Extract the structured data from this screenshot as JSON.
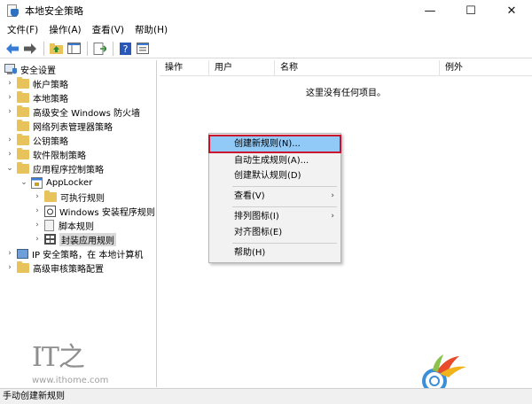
{
  "window": {
    "title": "本地安全策略",
    "minimize_glyph": "—",
    "maximize_glyph": "☐",
    "close_glyph": "✕"
  },
  "menubar": [
    {
      "label": "文件(F)"
    },
    {
      "label": "操作(A)"
    },
    {
      "label": "查看(V)"
    },
    {
      "label": "帮助(H)"
    }
  ],
  "toolbar": {
    "icons": [
      "back-arrow-icon",
      "forward-arrow-icon",
      "up-folder-icon",
      "show-hide-tree-icon",
      "export-list-icon",
      "help-icon",
      "properties-icon"
    ]
  },
  "tree": {
    "root": "安全设置",
    "items": [
      {
        "label": "帐户策略"
      },
      {
        "label": "本地策略"
      },
      {
        "label": "高级安全 Windows 防火墙"
      },
      {
        "label": "网络列表管理器策略"
      },
      {
        "label": "公钥策略"
      },
      {
        "label": "软件限制策略"
      },
      {
        "label": "应用程序控制策略"
      },
      {
        "label": "AppLocker"
      },
      {
        "label": "可执行规则"
      },
      {
        "label": "Windows 安装程序规则"
      },
      {
        "label": "脚本规则"
      },
      {
        "label": "封装应用规则"
      },
      {
        "label": "IP 安全策略，在 本地计算机"
      },
      {
        "label": "高级审核策略配置"
      }
    ]
  },
  "list": {
    "columns": [
      "操作",
      "用户",
      "名称",
      "例外"
    ],
    "empty_message": "这里没有任何项目。"
  },
  "context_menu": {
    "items": [
      {
        "label": "创建新规则(N)...",
        "highlighted": true
      },
      {
        "label": "自动生成规则(A)..."
      },
      {
        "label": "创建默认规则(D)"
      },
      {
        "label": "查看(V)",
        "submenu": true
      },
      {
        "label": "排列图标(I)",
        "submenu": true
      },
      {
        "label": "对齐图标(E)"
      },
      {
        "label": "帮助(H)"
      }
    ],
    "submenu_glyph": "›"
  },
  "watermark": {
    "logo": "IT之",
    "url": "www.ithome.com"
  },
  "statusbar": {
    "text": "手动创建新规则"
  },
  "colors": {
    "menu_highlight": "#91c9f7",
    "highlight_border": "#c8102e",
    "folder": "#e8c25a"
  }
}
